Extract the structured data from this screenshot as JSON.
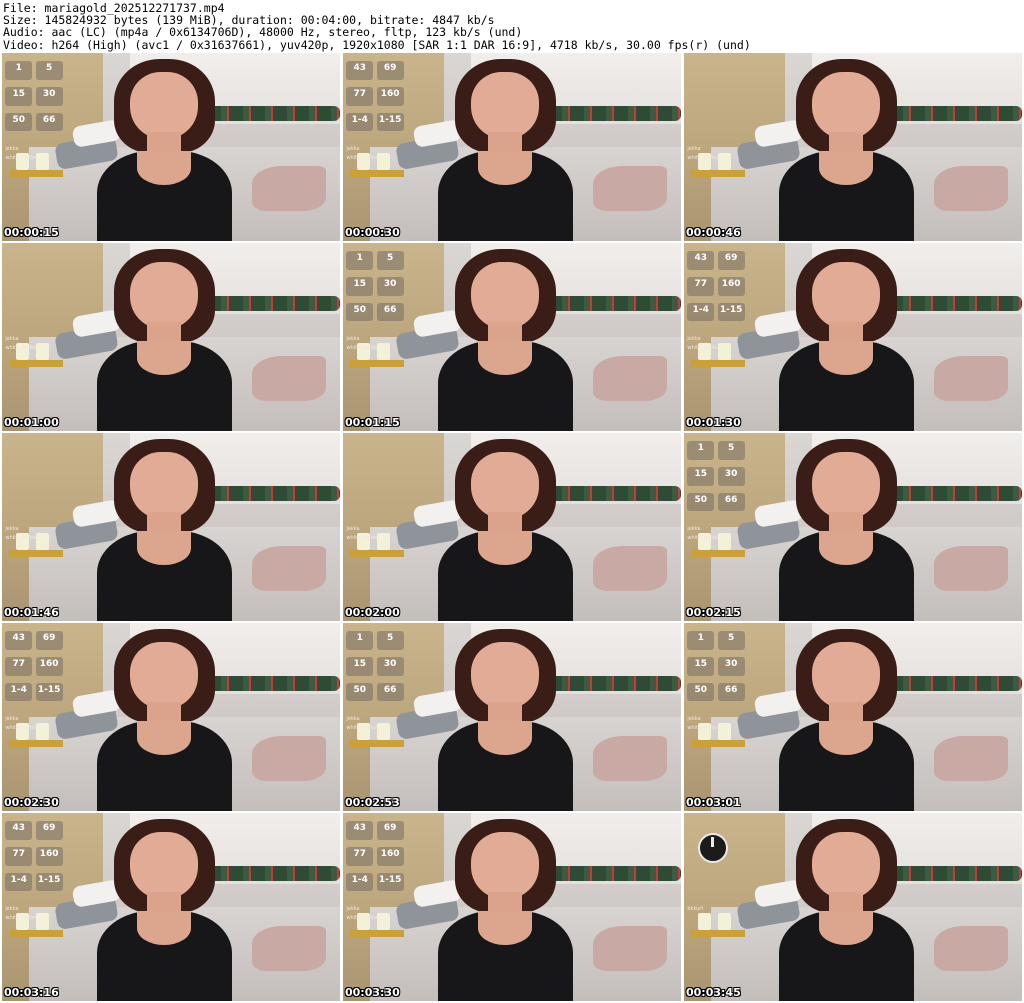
{
  "header": {
    "file_line": "File: mariagold_202512271737.mp4",
    "size_line": "Size: 145824932 bytes (139 MiB), duration: 00:04:00, bitrate: 4847 kb/s",
    "audio_line": "Audio: aac (LC) (mp4a / 0x6134706D), 48000 Hz, stereo, fltp, 123 kb/s (und)",
    "video_line": "Video: h264 (High) (avc1 / 0x31637661), yuv420p, 1920x1080 [SAR 1:1 DAR 16:9], 4718 kb/s, 30.00 fps(r) (und)"
  },
  "thumbnails": [
    {
      "timestamp": "00:00:15",
      "overlay": "a"
    },
    {
      "timestamp": "00:00:30",
      "overlay": "b"
    },
    {
      "timestamp": "00:00:46",
      "overlay": "c"
    },
    {
      "timestamp": "00:01:00",
      "overlay": "c"
    },
    {
      "timestamp": "00:01:15",
      "overlay": "a"
    },
    {
      "timestamp": "00:01:30",
      "overlay": "b"
    },
    {
      "timestamp": "00:01:46",
      "overlay": "c"
    },
    {
      "timestamp": "00:02:00",
      "overlay": "c"
    },
    {
      "timestamp": "00:02:15",
      "overlay": "a"
    },
    {
      "timestamp": "00:02:30",
      "overlay": "b"
    },
    {
      "timestamp": "00:02:53",
      "overlay": "a"
    },
    {
      "timestamp": "00:03:01",
      "overlay": "a"
    },
    {
      "timestamp": "00:03:16",
      "overlay": "b"
    },
    {
      "timestamp": "00:03:30",
      "overlay": "b"
    },
    {
      "timestamp": "00:03:45",
      "overlay": "d"
    }
  ],
  "overlay_sets": {
    "a": {
      "values": [
        "1",
        "5",
        "15",
        "30",
        "50",
        "66"
      ],
      "names": [
        "jekka",
        "white_rocker"
      ]
    },
    "b": {
      "values": [
        "43",
        "69",
        "77",
        "160",
        "1-4",
        "1-15"
      ],
      "names": [
        "jekka",
        "white_rocker"
      ]
    },
    "c": {
      "values": [],
      "names": [
        "jekka",
        "white_rocker"
      ]
    },
    "d": {
      "values": [],
      "names": [
        "bkkurt"
      ]
    }
  }
}
